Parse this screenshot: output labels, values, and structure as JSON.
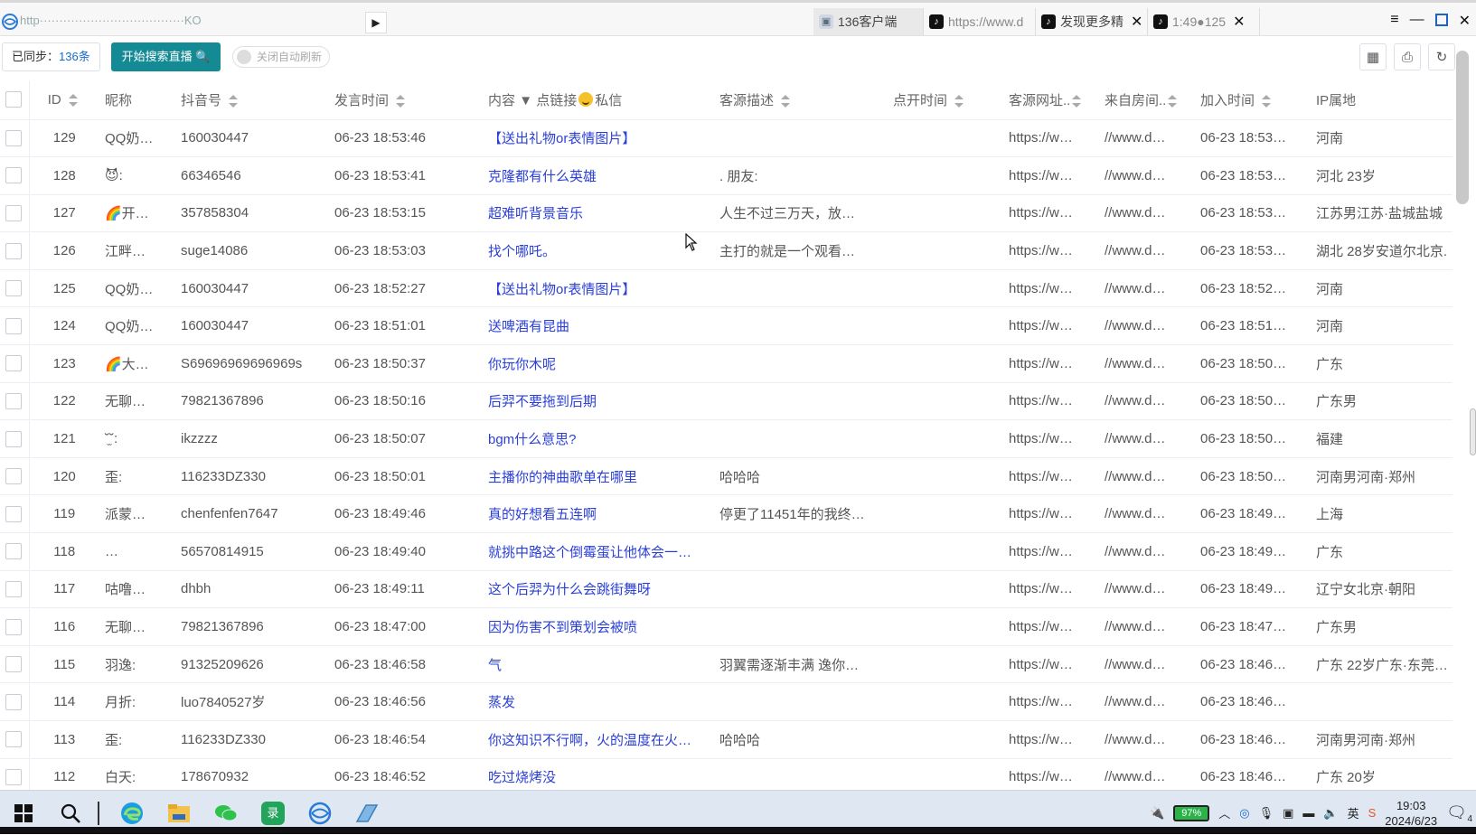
{
  "browser": {
    "url_text": "http·····································KO",
    "play_label": "▶",
    "tabs": [
      {
        "label": "136客户端",
        "icon": "page-icon",
        "active": true,
        "closable": false
      },
      {
        "label": "https://www.d",
        "icon": "tiktok-icon",
        "active": false,
        "closable": false
      },
      {
        "label": "发现更多精",
        "icon": "tiktok-icon",
        "active": false,
        "closable": true
      },
      {
        "label": "1:49●125",
        "icon": "tiktok-icon",
        "active": false,
        "closable": true
      }
    ],
    "win_menu": "≡",
    "win_min": "—",
    "win_close": "✕",
    "tab_close": "✕"
  },
  "toolbar": {
    "synced_prefix": "已同步：",
    "synced_count": "136条",
    "start_label": "开始搜索直播 🔍",
    "toggle_label": "关闭自动刷新",
    "icons": [
      "grid-icon",
      "print-icon",
      "refresh-icon"
    ],
    "icon_glyphs": [
      "▦",
      "⎙",
      "↻"
    ]
  },
  "table": {
    "headers": {
      "id": "ID",
      "nickname": "昵称",
      "douyin": "抖音号",
      "time": "发言时间",
      "content_a": "内容",
      "content_b": "▼ 点链接",
      "content_c": "私信",
      "desc": "客源描述",
      "open_time": "点开时间",
      "url": "客源网址..",
      "room": "来自房间..",
      "join": "加入时间",
      "ip": "IP属地"
    },
    "rows": [
      {
        "id": "129",
        "nick": "QQ奶…",
        "dy": "160030447",
        "time": "06-23 18:53:46",
        "content": "【送出礼物or表情图片】",
        "desc": "",
        "open": "",
        "url": "https://w…",
        "room": "//www.d…",
        "join": "06-23 18:53…",
        "ip": "河南"
      },
      {
        "id": "128",
        "nick": "😈:",
        "dy": "66346546",
        "time": "06-23 18:53:41",
        "content": "克隆都有什么英雄",
        "desc": ". 朋友:",
        "open": "",
        "url": "https://w…",
        "room": "//www.d…",
        "join": "06-23 18:53…",
        "ip": "河北 23岁"
      },
      {
        "id": "127",
        "nick": "🌈开…",
        "dy": "357858304",
        "time": "06-23 18:53:15",
        "content": "超难听背景音乐",
        "desc": "人生不过三万天，放…",
        "open": "",
        "url": "https://w…",
        "room": "//www.d…",
        "join": "06-23 18:53…",
        "ip": "江苏男江苏·盐城盐城"
      },
      {
        "id": "126",
        "nick": "江畔…",
        "dy": "suge14086",
        "time": "06-23 18:53:03",
        "content": "找个哪吒。",
        "desc": "主打的就是一个观看…",
        "open": "",
        "url": "https://w…",
        "room": "//www.d…",
        "join": "06-23 18:53…",
        "ip": "湖北 28岁安道尔北京."
      },
      {
        "id": "125",
        "nick": "QQ奶…",
        "dy": "160030447",
        "time": "06-23 18:52:27",
        "content": "【送出礼物or表情图片】",
        "desc": "",
        "open": "",
        "url": "https://w…",
        "room": "//www.d…",
        "join": "06-23 18:52…",
        "ip": "河南"
      },
      {
        "id": "124",
        "nick": "QQ奶…",
        "dy": "160030447",
        "time": "06-23 18:51:01",
        "content": "送啤酒有昆曲",
        "desc": "",
        "open": "",
        "url": "https://w…",
        "room": "//www.d…",
        "join": "06-23 18:51…",
        "ip": "河南"
      },
      {
        "id": "123",
        "nick": "🌈大…",
        "dy": "S69696969696969s",
        "time": "06-23 18:50:37",
        "content": "你玩你木呢",
        "desc": "",
        "open": "",
        "url": "https://w…",
        "room": "//www.d…",
        "join": "06-23 18:50…",
        "ip": "广东"
      },
      {
        "id": "122",
        "nick": "无聊…",
        "dy": "79821367896",
        "time": "06-23 18:50:16",
        "content": "后羿不要拖到后期",
        "desc": "",
        "open": "",
        "url": "https://w…",
        "room": "//www.d…",
        "join": "06-23 18:50…",
        "ip": "广东男"
      },
      {
        "id": "121",
        "nick": "˘̫˘:",
        "dy": "ikzzzz",
        "time": "06-23 18:50:07",
        "content": "bgm什么意思?",
        "desc": "",
        "open": "",
        "url": "https://w…",
        "room": "//www.d…",
        "join": "06-23 18:50…",
        "ip": "福建"
      },
      {
        "id": "120",
        "nick": "歪:",
        "dy": "116233DZ330",
        "time": "06-23 18:50:01",
        "content": "主播你的神曲歌单在哪里",
        "desc": "哈哈哈",
        "open": "",
        "url": "https://w…",
        "room": "//www.d…",
        "join": "06-23 18:50…",
        "ip": "河南男河南·郑州"
      },
      {
        "id": "119",
        "nick": "派蒙…",
        "dy": "chenfenfen7647",
        "time": "06-23 18:49:46",
        "content": "真的好想看五连啊",
        "desc": "停更了11451年的我终…",
        "open": "",
        "url": "https://w…",
        "room": "//www.d…",
        "join": "06-23 18:49…",
        "ip": "上海"
      },
      {
        "id": "118",
        "nick": "…",
        "dy": "56570814915",
        "time": "06-23 18:49:40",
        "content": "就挑中路这个倒霉蛋让他体会一…",
        "desc": "",
        "open": "",
        "url": "https://w…",
        "room": "//www.d…",
        "join": "06-23 18:49…",
        "ip": "广东"
      },
      {
        "id": "117",
        "nick": "咕噜…",
        "dy": "dhbh",
        "time": "06-23 18:49:11",
        "content": "这个后羿为什么会跳街舞呀",
        "desc": "",
        "open": "",
        "url": "https://w…",
        "room": "//www.d…",
        "join": "06-23 18:49…",
        "ip": "辽宁女北京·朝阳"
      },
      {
        "id": "116",
        "nick": "无聊…",
        "dy": "79821367896",
        "time": "06-23 18:47:00",
        "content": "因为伤害不到策划会被喷",
        "desc": "",
        "open": "",
        "url": "https://w…",
        "room": "//www.d…",
        "join": "06-23 18:47…",
        "ip": "广东男"
      },
      {
        "id": "115",
        "nick": "羽逸:",
        "dy": "91325209626",
        "time": "06-23 18:46:58",
        "content": "气",
        "desc": "羽翼需逐渐丰满 逸你…",
        "open": "",
        "url": "https://w…",
        "room": "//www.d…",
        "join": "06-23 18:46…",
        "ip": "广东 22岁广东·东莞…"
      },
      {
        "id": "114",
        "nick": "月折:",
        "dy": "luo7840527岁",
        "time": "06-23 18:46:56",
        "content": "蒸发",
        "desc": "",
        "open": "",
        "url": "https://w…",
        "room": "//www.d…",
        "join": "06-23 18:46…",
        "ip": ""
      },
      {
        "id": "113",
        "nick": "歪:",
        "dy": "116233DZ330",
        "time": "06-23 18:46:54",
        "content": "你这知识不行啊，火的温度在火…",
        "desc": "哈哈哈",
        "open": "",
        "url": "https://w…",
        "room": "//www.d…",
        "join": "06-23 18:46…",
        "ip": "河南男河南·郑州"
      },
      {
        "id": "112",
        "nick": "白天:",
        "dy": "178670932",
        "time": "06-23 18:46:52",
        "content": "吃过烧烤没",
        "desc": "",
        "open": "",
        "url": "https://w…",
        "room": "//www.d…",
        "join": "06-23 18:46…",
        "ip": "广东 20岁"
      }
    ]
  },
  "taskbar": {
    "apps": [
      "windows-start-icon",
      "search-icon",
      "edge-icon",
      "file-explorer-icon",
      "wechat-icon",
      "recorder-icon",
      "browser-app-icon",
      "client-app-icon"
    ],
    "battery": "97%",
    "ime": "英",
    "time": "19:03",
    "date": "2024/6/23",
    "notifications": "4"
  },
  "colors": {
    "accent": "#138a94",
    "link": "#2a3fd6",
    "count": "#1a6dcc"
  }
}
